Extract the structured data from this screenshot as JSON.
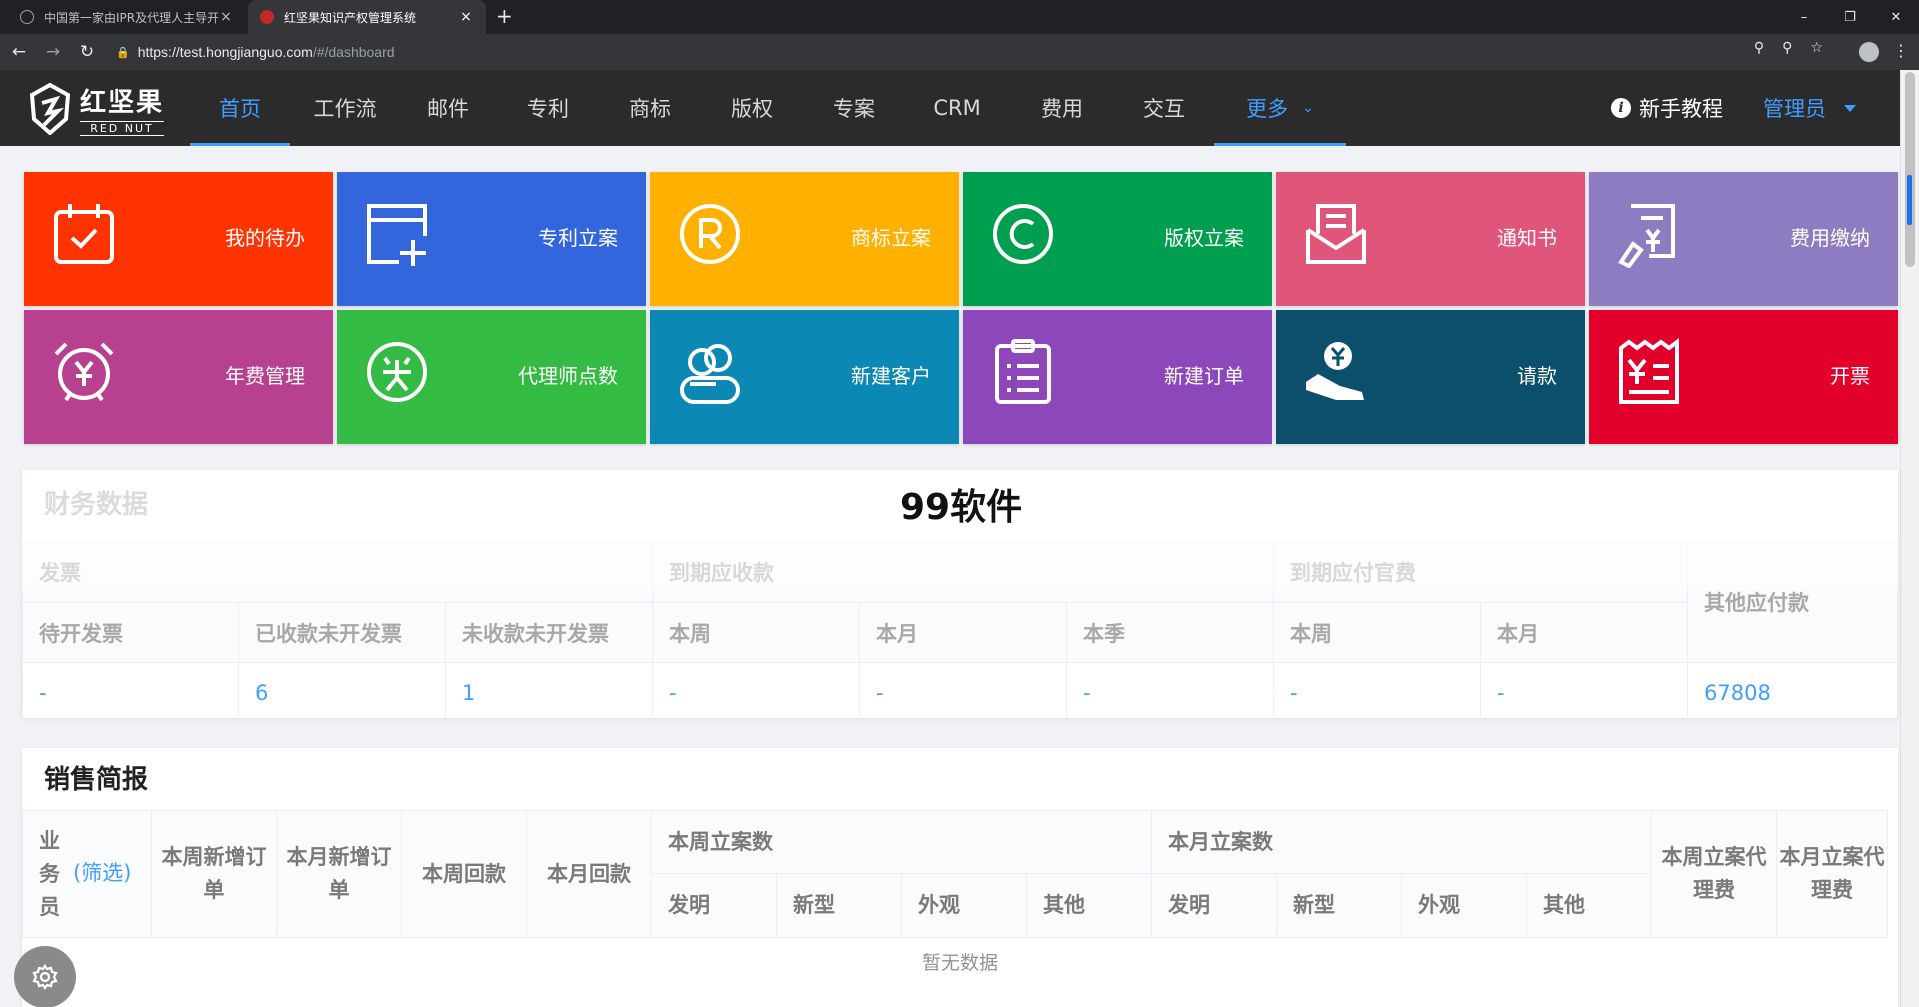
{
  "browser": {
    "tabs": [
      {
        "title": "中国第一家由IPR及代理人主导开",
        "close": "×"
      },
      {
        "title": "红坚果知识产权管理系统",
        "close": "×"
      }
    ],
    "new_tab": "+",
    "window_controls": [
      "–",
      "❐",
      "✕"
    ],
    "url_domain": "https://test.hongjianguo.com",
    "url_path": "/#/dashboard"
  },
  "app": {
    "logo_cn": "红坚果",
    "logo_en": "RED NUT",
    "nav": [
      {
        "label": "首页",
        "active": true
      },
      {
        "label": "工作流"
      },
      {
        "label": "邮件"
      },
      {
        "label": "专利"
      },
      {
        "label": "商标"
      },
      {
        "label": "版权"
      },
      {
        "label": "专案"
      },
      {
        "label": "CRM"
      },
      {
        "label": "费用"
      },
      {
        "label": "交互"
      },
      {
        "label": "更多",
        "active": true
      }
    ],
    "tutorial": "新手教程",
    "tutorial_icon": "i",
    "user": "管理员"
  },
  "tiles": [
    {
      "label": "我的待办",
      "color": "#ff3300",
      "icon": "calendar-check-icon"
    },
    {
      "label": "专利立案",
      "color": "#3366dd",
      "icon": "add-document-icon"
    },
    {
      "label": "商标立案",
      "color": "#ffb000",
      "icon": "registered-icon"
    },
    {
      "label": "版权立案",
      "color": "#009e4f",
      "icon": "copyright-icon"
    },
    {
      "label": "通知书",
      "color": "#e0557a",
      "icon": "mail-letter-icon"
    },
    {
      "label": "费用缴纳",
      "color": "#8e7cc3",
      "icon": "fee-payment-icon"
    },
    {
      "label": "年费管理",
      "color": "#b8418f",
      "icon": "alarm-yen-icon"
    },
    {
      "label": "代理师点数",
      "color": "#33bb44",
      "icon": "award-icon"
    },
    {
      "label": "新建客户",
      "color": "#0b88b4",
      "icon": "users-icon"
    },
    {
      "label": "新建订单",
      "color": "#8c47bb",
      "icon": "order-list-icon"
    },
    {
      "label": "请款",
      "color": "#0b4f6c",
      "icon": "hand-yen-icon"
    },
    {
      "label": "开票",
      "color": "#e2002b",
      "icon": "invoice-icon"
    }
  ],
  "watermark": "99软件",
  "finance": {
    "title": "财务数据",
    "groups": [
      "发票",
      "到期应收款",
      "到期应付官费",
      "其他应付款"
    ],
    "columns": [
      "待开发票",
      "已收款未开发票",
      "未收款未开发票",
      "本周",
      "本月",
      "本季",
      "本周",
      "本月"
    ],
    "values": [
      "-",
      "6",
      "1",
      "-",
      "-",
      "-",
      "-",
      "-",
      "67808"
    ]
  },
  "sales": {
    "title": "销售简报",
    "salesperson": "业务员",
    "filter": "(筛选)",
    "cols": [
      "本周新增订单",
      "本月新增订单",
      "本周回款",
      "本月回款"
    ],
    "week_cases": "本周立案数",
    "month_cases": "本月立案数",
    "case_types": [
      "发明",
      "新型",
      "外观",
      "其他"
    ],
    "week_fee": "本周立案代理费",
    "month_fee": "本月立案代理费",
    "empty": "暂无数据"
  }
}
